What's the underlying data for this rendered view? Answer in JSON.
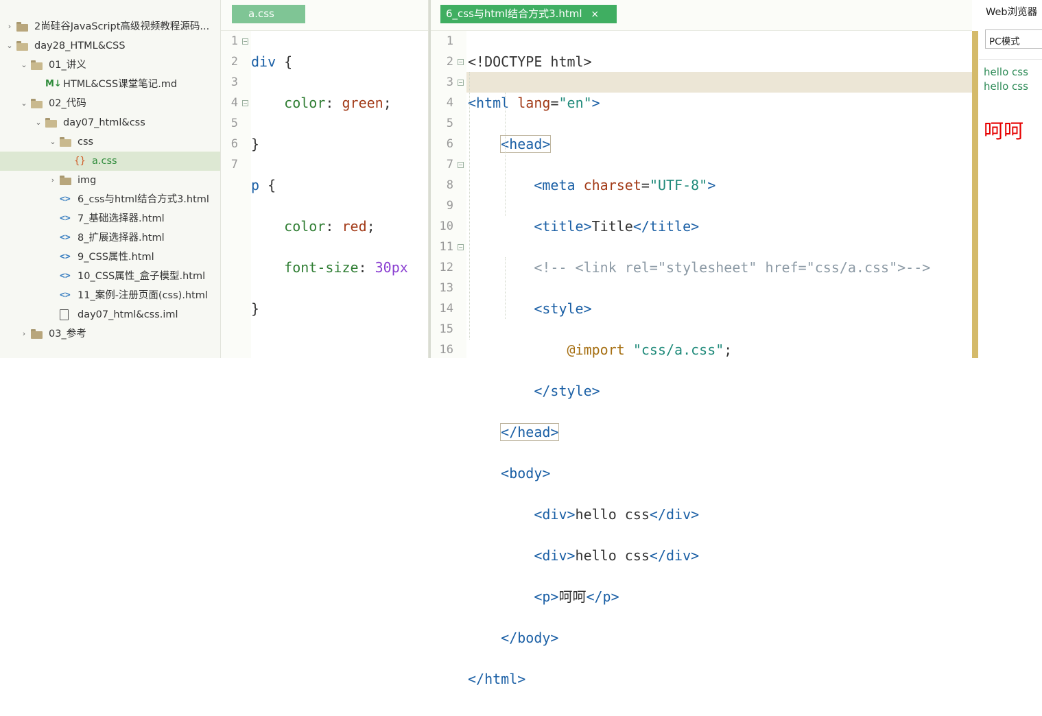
{
  "tree": {
    "items": [
      {
        "label": "2尚硅谷JavaScript高级视频教程源码...",
        "icon": "folder-icon",
        "arrow": "›",
        "depth": 0
      },
      {
        "label": "day28_HTML&CSS",
        "icon": "folder-open-icon",
        "arrow": "⌄",
        "depth": 0
      },
      {
        "label": "01_讲义",
        "icon": "folder-open-icon",
        "arrow": "⌄",
        "depth": 1
      },
      {
        "label": "HTML&CSS课堂笔记.md",
        "icon": "markdown-icon",
        "glyph": "M↓",
        "depth": 2
      },
      {
        "label": "02_代码",
        "icon": "folder-open-icon",
        "arrow": "⌄",
        "depth": 1
      },
      {
        "label": "day07_html&css",
        "icon": "folder-open-icon",
        "arrow": "⌄",
        "depth": 2
      },
      {
        "label": "css",
        "icon": "folder-open-icon",
        "arrow": "⌄",
        "depth": 3
      },
      {
        "label": "a.css",
        "icon": "css-file-icon",
        "glyph": "{}",
        "depth": 4,
        "selected": true
      },
      {
        "label": "img",
        "icon": "folder-icon",
        "arrow": "›",
        "depth": 3
      },
      {
        "label": "6_css与html结合方式3.html",
        "icon": "html-file-icon",
        "glyph": "<>",
        "depth": 3
      },
      {
        "label": "7_基础选择器.html",
        "icon": "html-file-icon",
        "glyph": "<>",
        "depth": 3
      },
      {
        "label": "8_扩展选择器.html",
        "icon": "html-file-icon",
        "glyph": "<>",
        "depth": 3
      },
      {
        "label": "9_CSS属性.html",
        "icon": "html-file-icon",
        "glyph": "<>",
        "depth": 3
      },
      {
        "label": "10_CSS属性_盒子模型.html",
        "icon": "html-file-icon",
        "glyph": "<>",
        "depth": 3
      },
      {
        "label": "11_案例-注册页面(css).html",
        "icon": "html-file-icon",
        "glyph": "<>",
        "depth": 3
      },
      {
        "label": "day07_html&css.iml",
        "icon": "file-icon",
        "depth": 3
      },
      {
        "label": "03_参考",
        "icon": "folder-icon",
        "arrow": "›",
        "depth": 1
      }
    ]
  },
  "css_editor": {
    "tab": "a.css",
    "line_numbers": [
      "1",
      "2",
      "3",
      "4",
      "5",
      "6",
      "7"
    ]
  },
  "html_editor": {
    "tab": "6_css与html结合方式3.html",
    "tab_close": "×",
    "line_numbers": [
      "1",
      "2",
      "3",
      "4",
      "5",
      "6",
      "7",
      "8",
      "9",
      "10",
      "11",
      "12",
      "13",
      "14",
      "15",
      "16"
    ]
  },
  "preview": {
    "title": "Web浏览器",
    "mode": "PC模式",
    "div1": "hello css",
    "div2": "hello css",
    "p": "呵呵"
  },
  "colors": {
    "tab_active": "#3fae61",
    "selection": "#dde8d3",
    "current_line": "#ece6d6",
    "scrollbar": "#d4ba6a",
    "preview_green": "#2e8b57",
    "preview_red": "#e60000"
  }
}
